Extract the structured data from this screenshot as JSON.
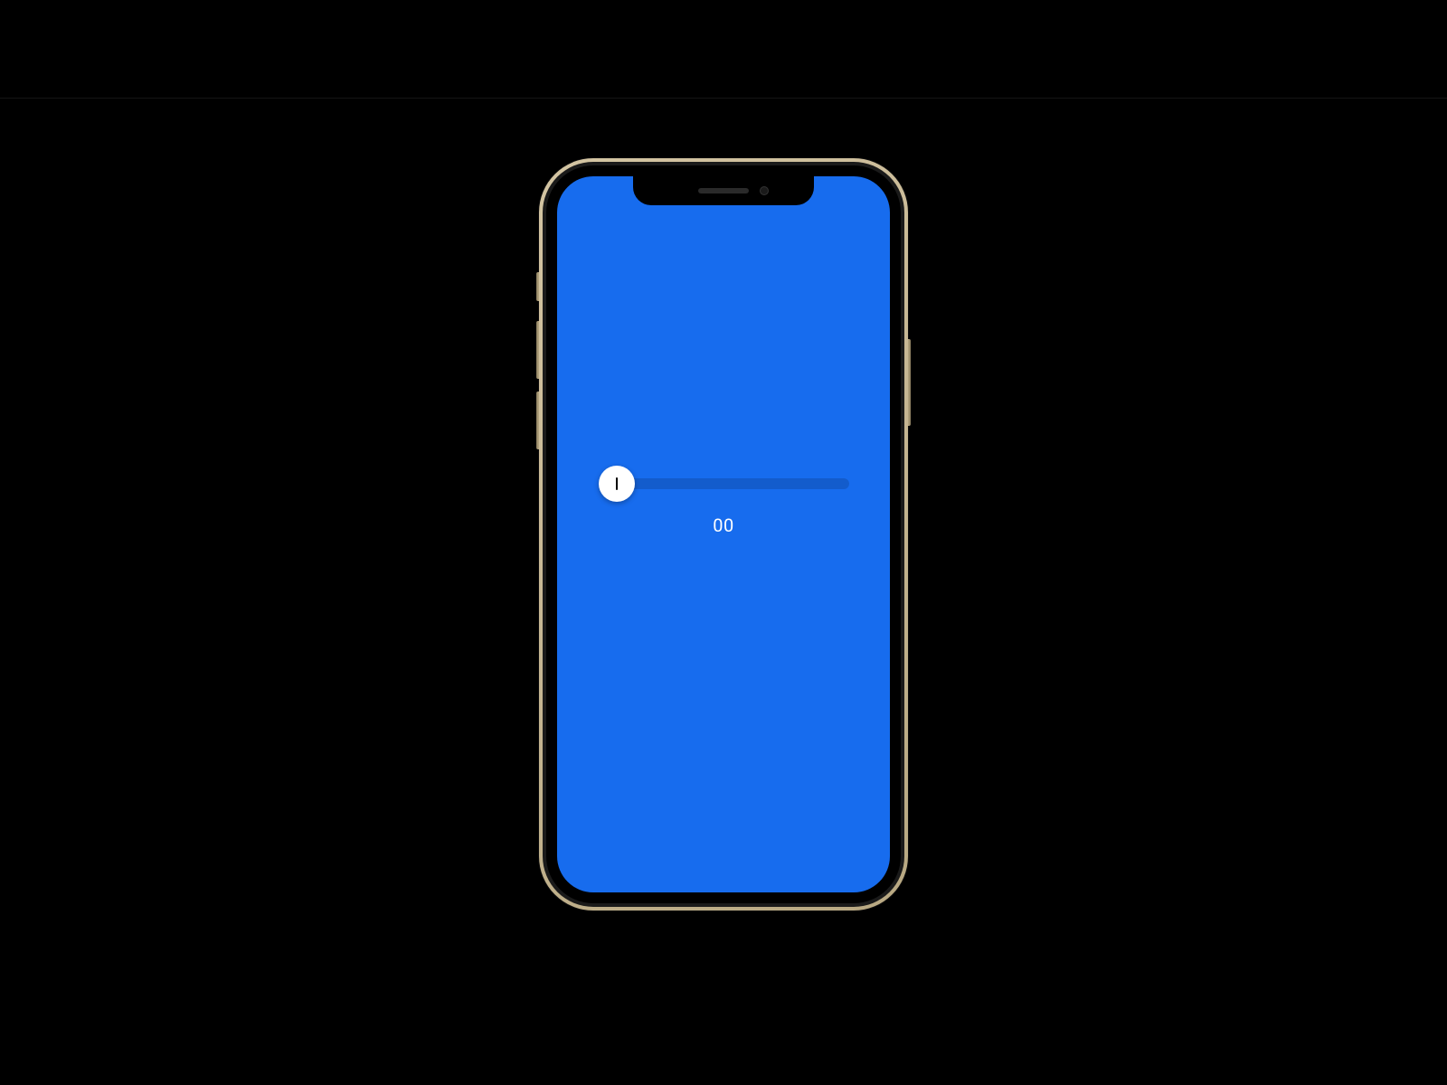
{
  "colors": {
    "screen_bg": "#176CEE",
    "page_bg": "#000000",
    "thumb_bg": "#ffffff"
  },
  "slider": {
    "value_text": "00",
    "position_percent": 0
  }
}
